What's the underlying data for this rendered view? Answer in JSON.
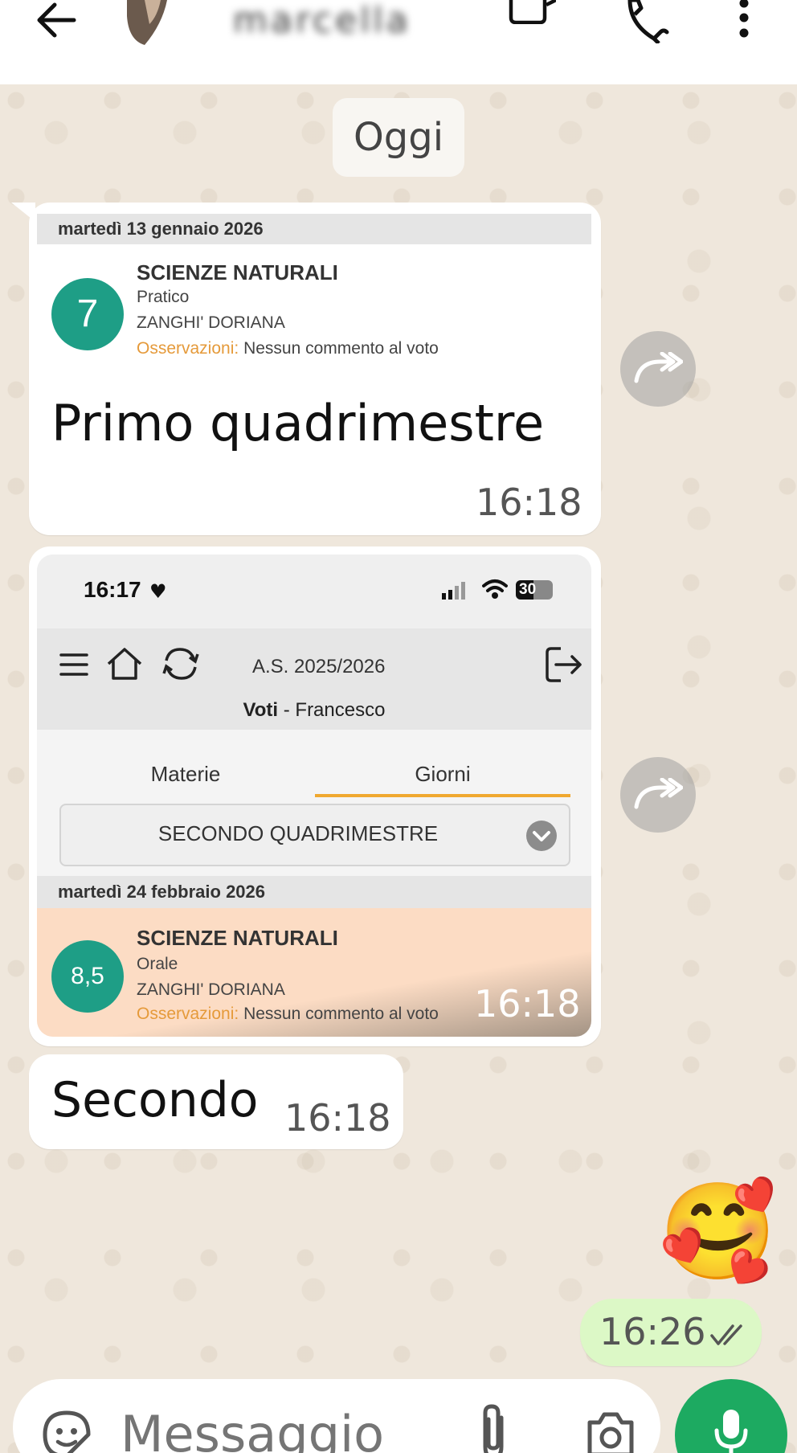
{
  "header": {
    "contact_name": "marcella"
  },
  "chat": {
    "date_chip": "Oggi",
    "messages": [
      {
        "card": {
          "date": "martedì 13 gennaio 2026",
          "grade": "7",
          "subject": "SCIENZE NATURALI",
          "type": "Pratico",
          "teacher": "ZANGHI' DORIANA",
          "obs_label": "Osservazioni:",
          "obs_text": "Nessun commento al voto"
        },
        "text": "Primo quadrimestre",
        "time": "16:18"
      },
      {
        "screenshot": {
          "status_time": "16:17",
          "battery": "30",
          "school_year": "A.S. 2025/2026",
          "title_bold": "Voti",
          "title_rest": " - Francesco",
          "tab_subjects": "Materie",
          "tab_days": "Giorni",
          "period_select": "SECONDO QUADRIMESTRE",
          "date": "martedì 24 febbraio 2026",
          "grade": "8,5",
          "subject": "SCIENZE NATURALI",
          "type": "Orale",
          "teacher": "ZANGHI' DORIANA",
          "obs_label": "Osservazioni:",
          "obs_text": "Nessun commento al voto"
        },
        "time": "16:18"
      },
      {
        "text": "Secondo",
        "time": "16:18"
      },
      {
        "emoji": "🥰",
        "time": "16:26"
      }
    ]
  },
  "composer": {
    "placeholder": "Messaggio"
  },
  "colors": {
    "accent": "#1daa61",
    "grade": "#1e9e86",
    "observation": "#e59a3a",
    "active_tab": "#f0a830"
  }
}
